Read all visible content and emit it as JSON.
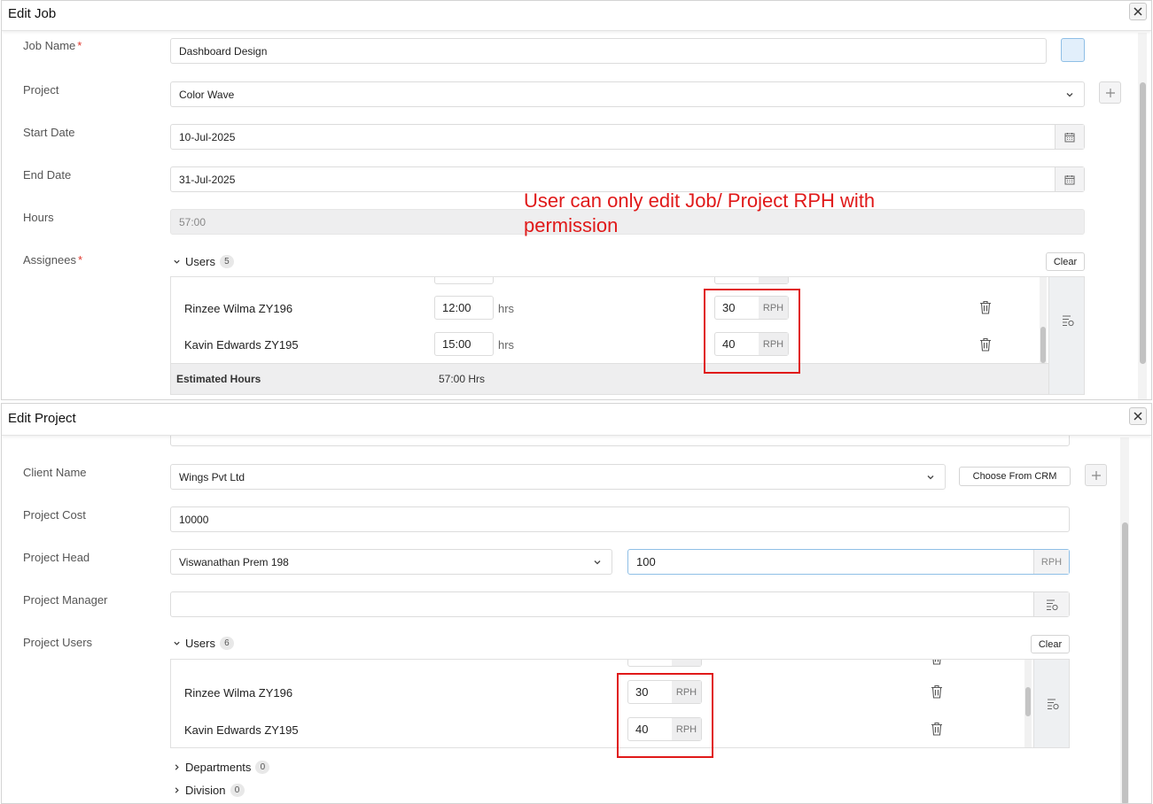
{
  "edit_job": {
    "title": "Edit Job",
    "fields": {
      "job_name_label": "Job Name",
      "job_name_value": "Dashboard Design",
      "project_label": "Project",
      "project_value": "Color Wave",
      "start_date_label": "Start Date",
      "start_date_value": "10-Jul-2025",
      "end_date_label": "End Date",
      "end_date_value": "31-Jul-2025",
      "hours_label": "Hours",
      "hours_value": "57:00",
      "assignees_label": "Assignees"
    },
    "users_toggle": "Users",
    "users_count": "5",
    "clear_label": "Clear",
    "users": [
      {
        "name": "Rinzee Wilma ZY196",
        "hours": "12:00",
        "hours_unit": "hrs",
        "rph": "30",
        "rph_unit": "RPH"
      },
      {
        "name": "Kavin Edwards ZY195",
        "hours": "15:00",
        "hours_unit": "hrs",
        "rph": "40",
        "rph_unit": "RPH"
      }
    ],
    "estimated_label": "Estimated Hours",
    "estimated_value": "57:00 Hrs"
  },
  "annotation": "User can only edit  Job/ Project RPH with permission",
  "edit_project": {
    "title": "Edit Project",
    "fields": {
      "client_name_label": "Client Name",
      "client_name_value": "Wings Pvt Ltd",
      "choose_crm_label": "Choose From CRM",
      "project_cost_label": "Project Cost",
      "project_cost_value": "10000",
      "project_head_label": "Project Head",
      "project_head_value": "Viswanathan Prem 198",
      "project_head_rph_value": "100",
      "project_head_rph_unit": "RPH",
      "project_manager_label": "Project Manager",
      "project_users_label": "Project Users"
    },
    "users_toggle": "Users",
    "users_count": "6",
    "clear_label": "Clear",
    "users": [
      {
        "name": "Rinzee Wilma ZY196",
        "rph": "30",
        "rph_unit": "RPH"
      },
      {
        "name": "Kavin Edwards ZY195",
        "rph": "40",
        "rph_unit": "RPH"
      }
    ],
    "departments_label": "Departments",
    "departments_count": "0",
    "division_label": "Division",
    "division_count": "0"
  },
  "colors": {
    "annotation_red": "#e01919",
    "required_star": "#e0352b",
    "focus_border": "#8fbfe6"
  },
  "icons": [
    "close-icon",
    "chevron-down-icon",
    "calendar-icon",
    "plus-icon",
    "trash-icon",
    "user-list-icon",
    "chevron-right-icon"
  ]
}
